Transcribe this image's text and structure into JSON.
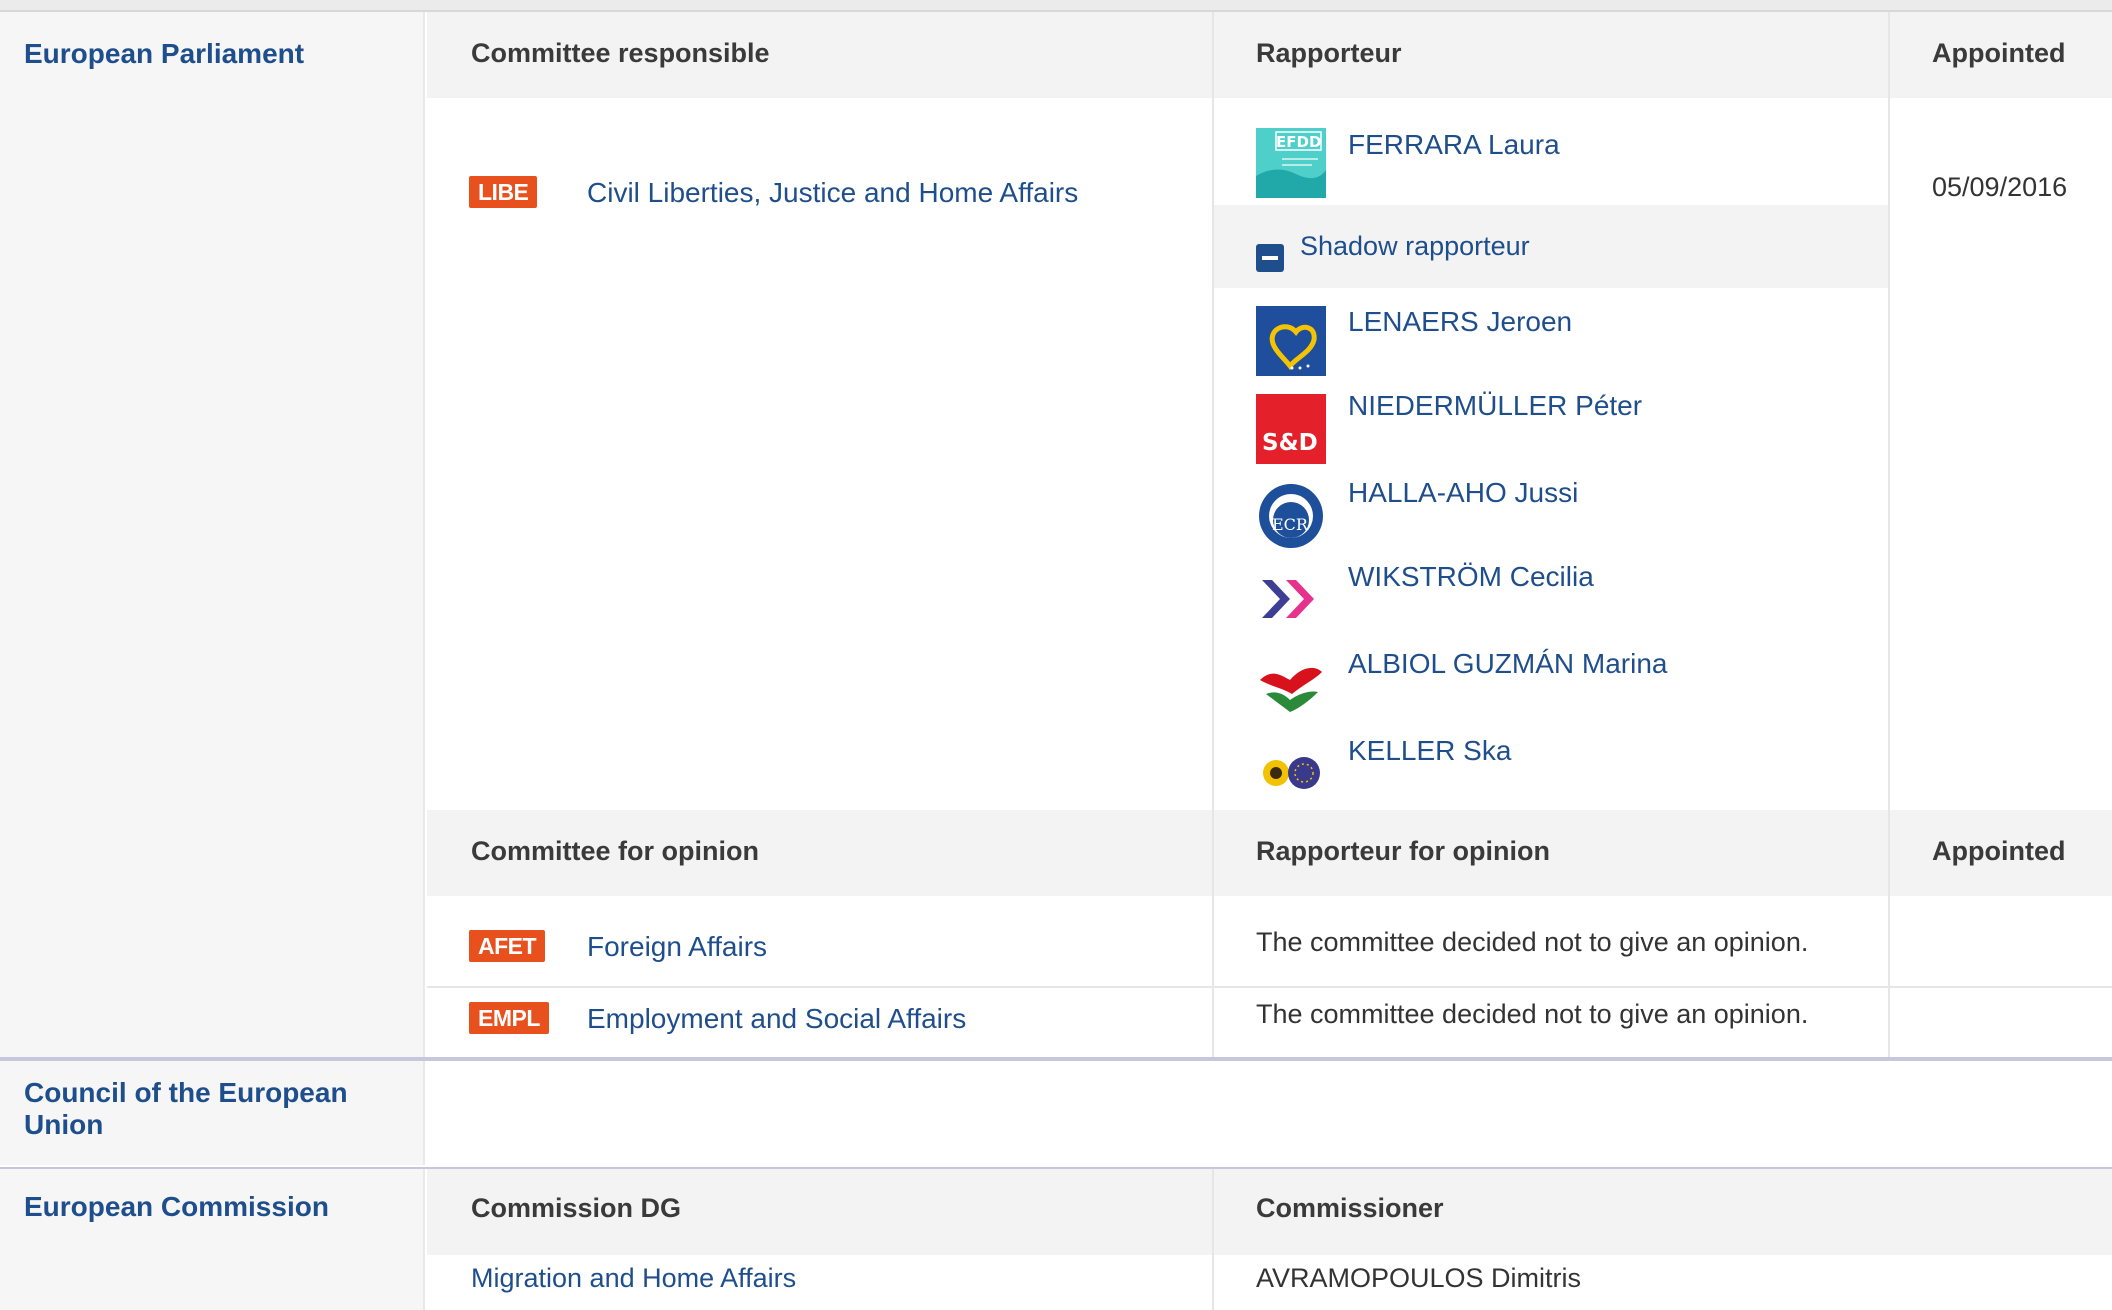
{
  "european_parliament": {
    "label": "European Parliament",
    "committee_responsible_header": "Committee responsible",
    "rapporteur_header": "Rapporteur",
    "appointed_header": "Appointed",
    "committee": {
      "code": "LIBE",
      "name": "Civil Liberties, Justice and Home Affairs"
    },
    "rapporteur": {
      "name": "FERRARA Laura",
      "group_logo": "efdd-logo",
      "group_logo_text": "EFDD"
    },
    "appointed_date": "05/09/2016",
    "shadow_toggle_label": "Shadow rapporteur",
    "shadow_rapporteurs": [
      {
        "name": "LENAERS Jeroen",
        "group_logo": "epp-logo"
      },
      {
        "name": "NIEDERMÜLLER Péter",
        "group_logo": "sd-logo",
        "logo_text": "S&D"
      },
      {
        "name": "HALLA-AHO Jussi",
        "group_logo": "ecr-logo",
        "logo_text": "ECR"
      },
      {
        "name": "WIKSTRÖM Cecilia",
        "group_logo": "alde-logo"
      },
      {
        "name": "ALBIOL GUZMÁN Marina",
        "group_logo": "gue-ngl-logo"
      },
      {
        "name": "KELLER Ska",
        "group_logo": "greens-efa-logo"
      }
    ],
    "committee_opinion_header": "Committee for opinion",
    "rapporteur_opinion_header": "Rapporteur for opinion",
    "appointed_opinion_header": "Appointed",
    "opinions": [
      {
        "code": "AFET",
        "name": "Foreign Affairs",
        "rapporteur_text": "The committee decided not to give an opinion."
      },
      {
        "code": "EMPL",
        "name": "Employment and Social Affairs",
        "rapporteur_text": "The committee decided not to give an opinion."
      }
    ]
  },
  "council": {
    "label": "Council of the European Union"
  },
  "commission": {
    "label": "European Commission",
    "dg_header": "Commission DG",
    "commissioner_header": "Commissioner",
    "dg_name": "Migration and Home Affairs",
    "commissioner_name": "AVRAMOPOULOS Dimitris"
  },
  "colors": {
    "badge": "#e8501e",
    "link": "#1f4e8c",
    "header_bg": "#f3f3f3",
    "institution_bg": "#f6f6f6"
  }
}
